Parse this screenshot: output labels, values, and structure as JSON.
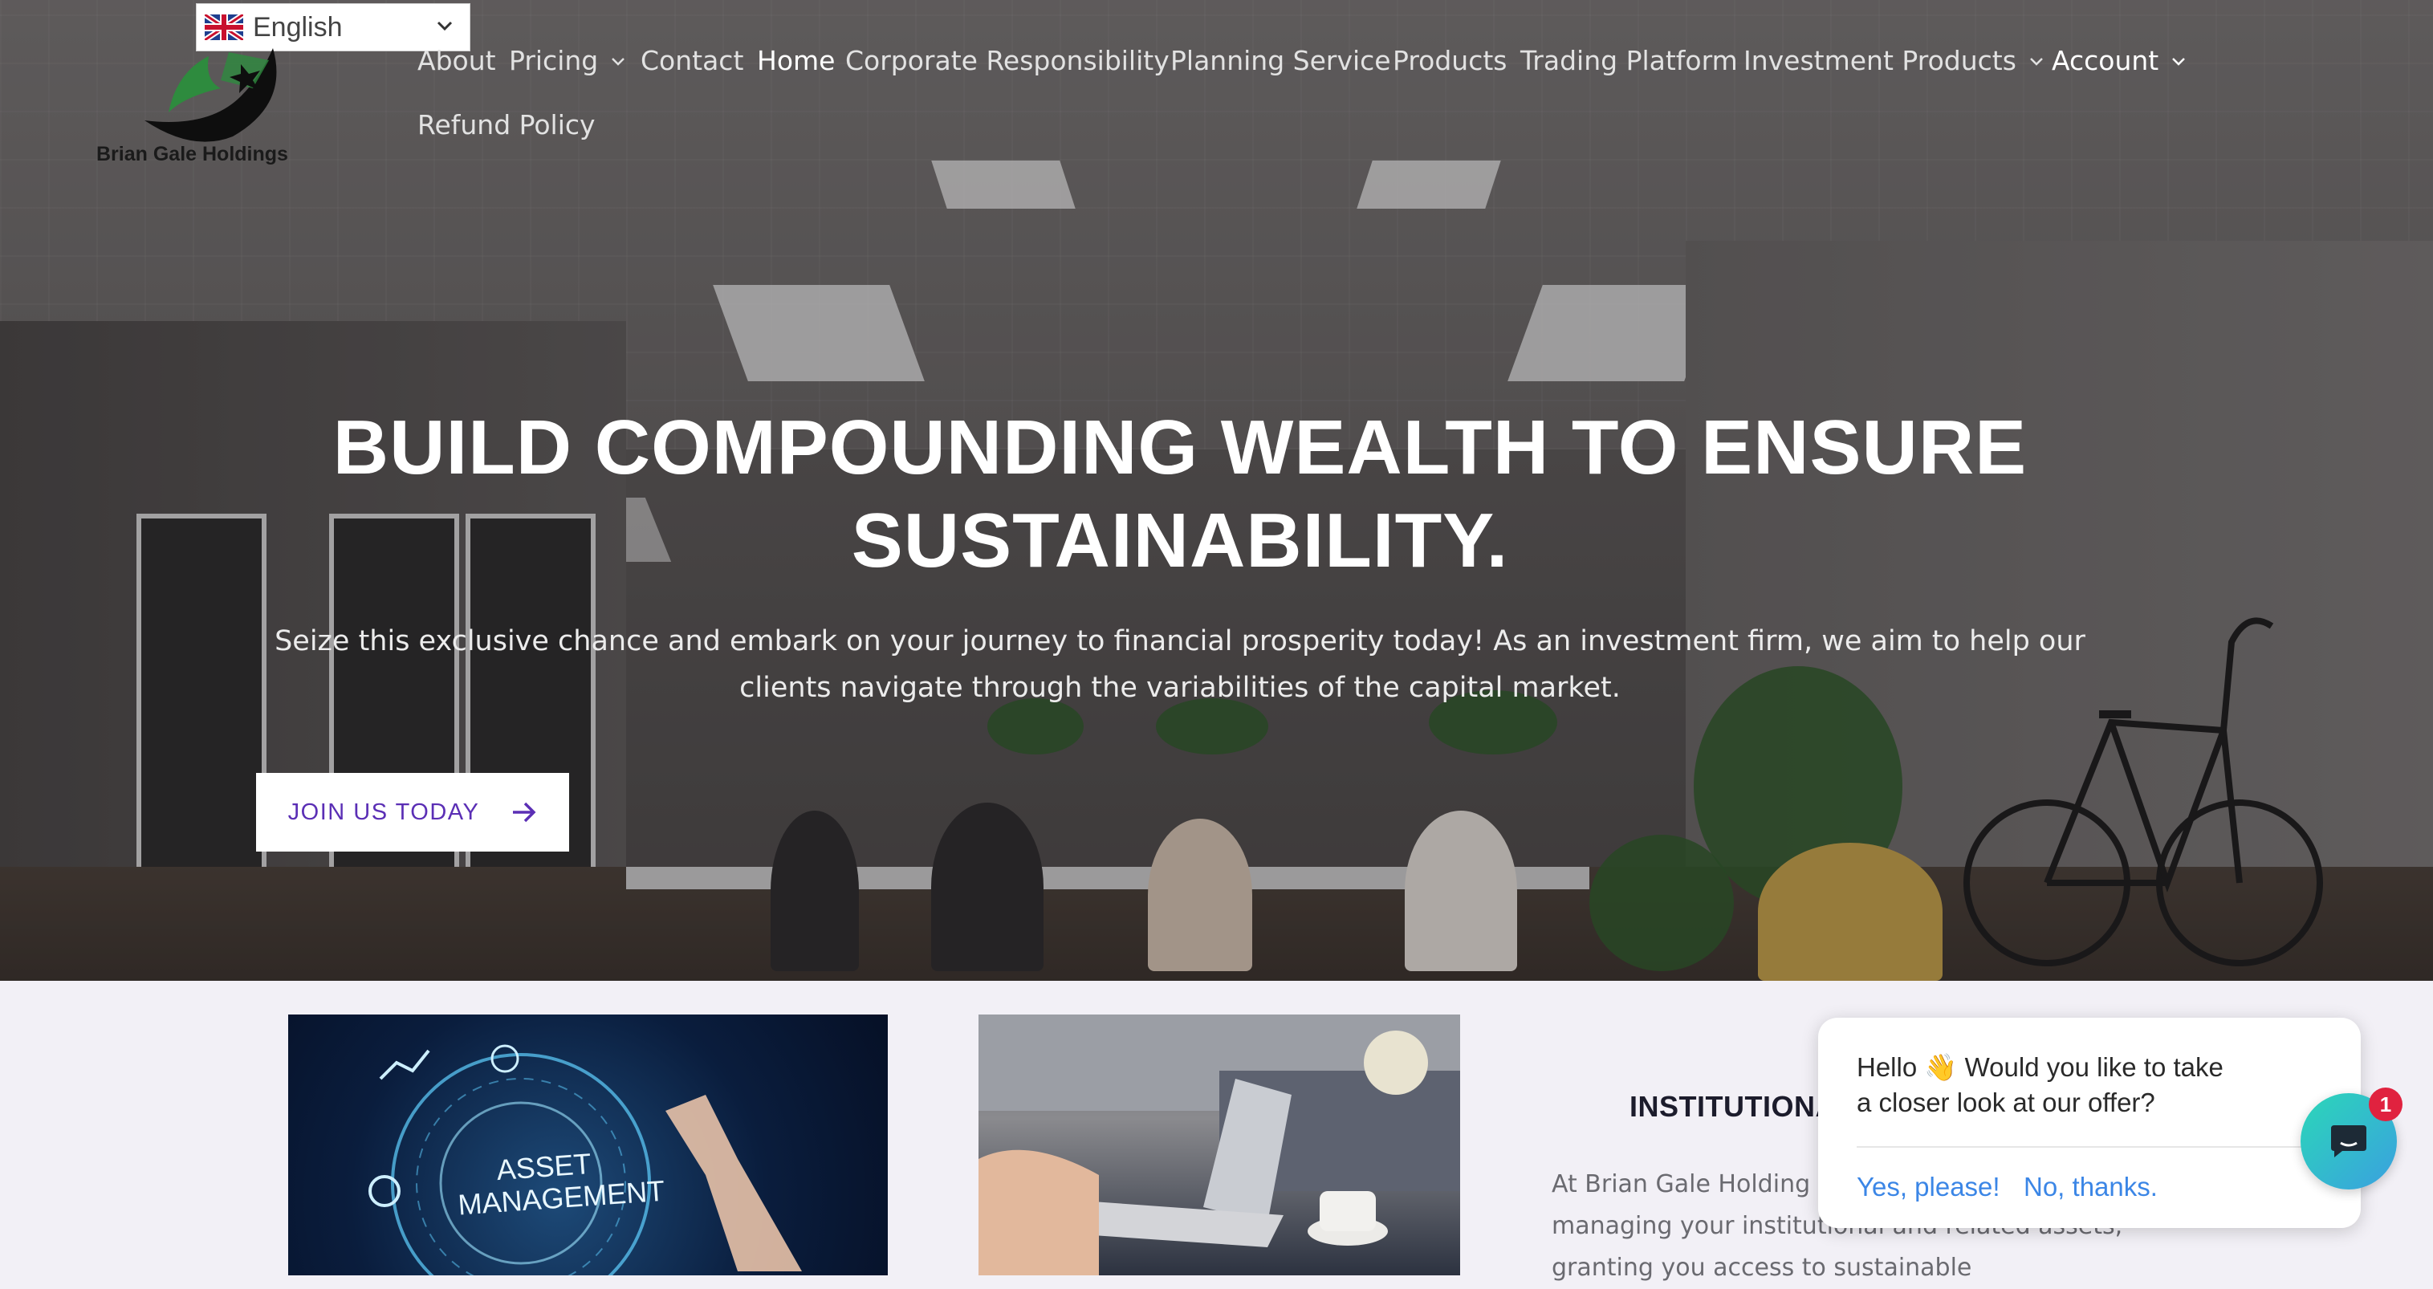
{
  "language_selector": {
    "value": "English",
    "icon": "uk-flag-icon"
  },
  "brand": {
    "name": "Brian Gale Holdings",
    "accent": "#2e8b3e"
  },
  "nav": {
    "items": [
      {
        "label": "About"
      },
      {
        "label": "Pricing"
      },
      {
        "label": "Contact"
      },
      {
        "label": "Home"
      },
      {
        "label": "Corporate Responsibility"
      },
      {
        "label": "Planning Service"
      },
      {
        "label": "Products"
      },
      {
        "label": "Trading Platform"
      },
      {
        "label": "Investment Products"
      },
      {
        "label": "Account"
      },
      {
        "label": "Refund Policy"
      }
    ]
  },
  "hero": {
    "title_line1": "BUILD COMPOUNDING WEALTH TO ENSURE",
    "title_line2": "SUSTAINABILITY.",
    "subtitle_line1": "Seize this exclusive chance and embark on your journey to financial prosperity today! As an investment firm, we aim to help our",
    "subtitle_line2": "clients navigate through the variabilities of the capital market.",
    "cta_label": "JOIN US TODAY",
    "cta_color": "#5b2fb5"
  },
  "cards": {
    "asset_line1": "ASSET",
    "asset_line2": "MANAGEMENT"
  },
  "institutional": {
    "title": "INSTITUTIONA",
    "body_line1": "At Brian Gale Holding",
    "body_line2": "managing your institutional and related assets,",
    "body_line3": "granting you access to sustainable"
  },
  "chat": {
    "message_line1": "Hello 👋 Would you like to take",
    "message_line2": "a closer look at our offer?",
    "yes_label": "Yes, please!",
    "no_label": "No, thanks.",
    "badge_count": "1",
    "link_color": "#3b86e6"
  }
}
